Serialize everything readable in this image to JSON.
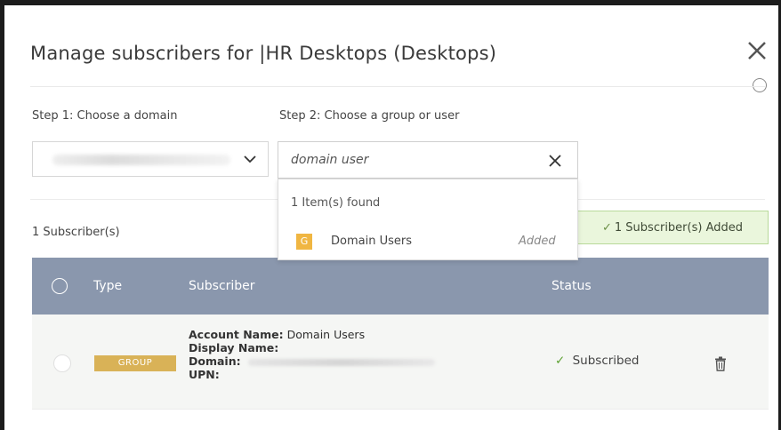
{
  "dialog": {
    "title": "Manage subscribers for |HR Desktops (Desktops)"
  },
  "steps": {
    "step1_label": "Step 1: Choose a domain",
    "step2_label": "Step 2: Choose a group or user"
  },
  "search": {
    "value": "domain user"
  },
  "dropdown": {
    "found_text": "1 Item(s) found",
    "items": [
      {
        "icon_letter": "G",
        "name": "Domain Users",
        "status": "Added"
      }
    ]
  },
  "subscribers": {
    "count_text": "1 Subscriber(s)",
    "added_badge": "1 Subscriber(s) Added"
  },
  "table": {
    "headers": {
      "type": "Type",
      "subscriber": "Subscriber",
      "status": "Status"
    },
    "rows": [
      {
        "type_badge": "GROUP",
        "account_label": "Account Name:",
        "account_value": "Domain Users",
        "display_label": "Display Name:",
        "domain_label": "Domain:",
        "upn_label": "UPN:",
        "status": "Subscribed"
      }
    ]
  },
  "colors": {
    "header_bg": "#8a97ad",
    "group_badge": "#d9b257",
    "added_badge_bg": "#eaf6dc",
    "success": "#5fa234"
  },
  "icons": {
    "close": "close-icon",
    "chevron": "chevron-down-icon",
    "clear": "clear-icon",
    "check": "check-icon",
    "trash": "trash-icon",
    "group": "group-letter-icon"
  }
}
